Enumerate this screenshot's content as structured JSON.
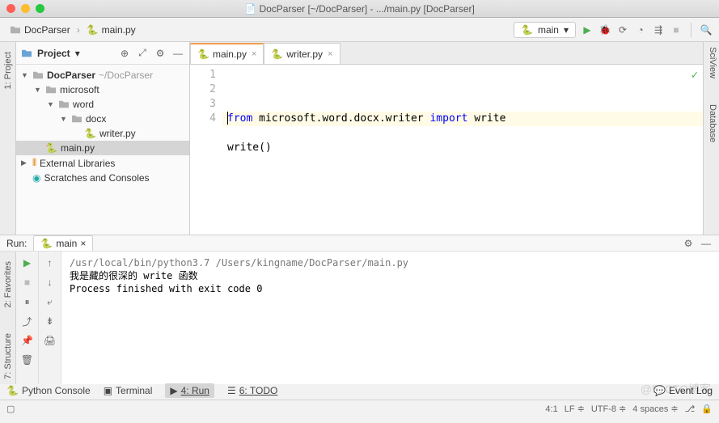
{
  "window_title": "DocParser [~/DocParser] - .../main.py [DocParser]",
  "breadcrumb": {
    "items": [
      "DocParser",
      "main.py"
    ]
  },
  "run_config": "main",
  "left_tabs": [
    "1: Project"
  ],
  "right_tabs": [
    "SciView",
    "Database"
  ],
  "project": {
    "label": "Project",
    "tree": [
      {
        "name": "DocParser",
        "hint": "~/DocParser",
        "kind": "project",
        "depth": 0,
        "expanded": true
      },
      {
        "name": "microsoft",
        "kind": "folder",
        "depth": 1,
        "expanded": true
      },
      {
        "name": "word",
        "kind": "folder",
        "depth": 2,
        "expanded": true
      },
      {
        "name": "docx",
        "kind": "folder",
        "depth": 3,
        "expanded": true
      },
      {
        "name": "writer.py",
        "kind": "py",
        "depth": 4
      },
      {
        "name": "main.py",
        "kind": "py",
        "depth": 1,
        "selected": true
      },
      {
        "name": "External Libraries",
        "kind": "lib",
        "depth": 0,
        "collapsed": true
      },
      {
        "name": "Scratches and Consoles",
        "kind": "scratch",
        "depth": 0
      }
    ]
  },
  "editor": {
    "tabs": [
      {
        "label": "main.py",
        "active": true
      },
      {
        "label": "writer.py",
        "active": false
      }
    ],
    "current_line": 4,
    "lines": [
      {
        "n": 1,
        "tokens": [
          {
            "t": "from ",
            "c": "kw"
          },
          {
            "t": "microsoft.word.docx.writer ",
            "c": "ident"
          },
          {
            "t": "import ",
            "c": "kw"
          },
          {
            "t": "write",
            "c": "ident"
          }
        ]
      },
      {
        "n": 2,
        "tokens": []
      },
      {
        "n": 3,
        "tokens": [
          {
            "t": "write()",
            "c": "ident"
          }
        ]
      },
      {
        "n": 4,
        "tokens": []
      }
    ]
  },
  "run": {
    "label": "Run:",
    "tab": "main",
    "lines": [
      {
        "t": "/usr/local/bin/python3.7 /Users/kingname/DocParser/main.py",
        "c": "path"
      },
      {
        "t": "我是藏的很深的 write 函数",
        "c": "msg"
      },
      {
        "t": " ",
        "c": ""
      },
      {
        "t": "Process finished with exit code 0",
        "c": "exit"
      }
    ]
  },
  "bottom_tabs": [
    {
      "label": "Python Console"
    },
    {
      "label": "Terminal"
    },
    {
      "label": "4: Run",
      "active": true
    },
    {
      "label": "6: TODO"
    }
  ],
  "left_side_tabs2": [
    "2: Favorites",
    "7: Structure"
  ],
  "event_log": "Event Log",
  "status": {
    "pos": "4:1",
    "le": "LF",
    "enc": "UTF-8",
    "indent": "4 spaces"
  },
  "watermark": "@51CTO博客"
}
